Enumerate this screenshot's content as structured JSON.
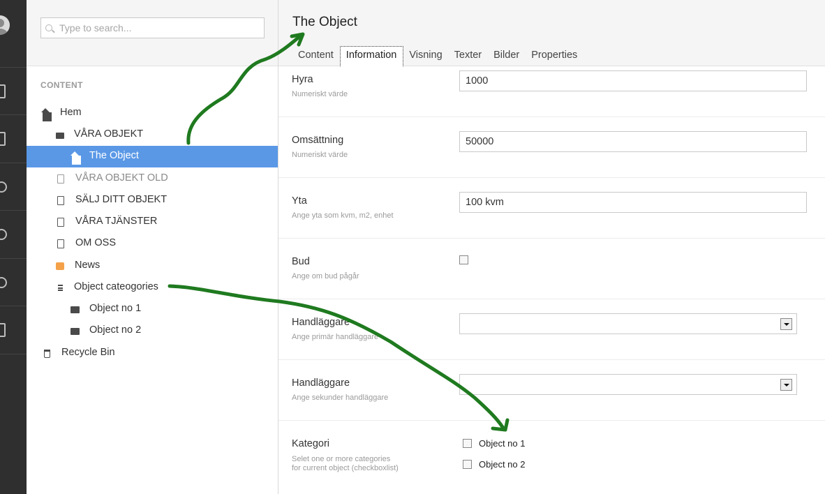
{
  "search": {
    "placeholder": "Type to search..."
  },
  "tree": {
    "heading": "CONTENT",
    "nodes": [
      {
        "label": "Hem",
        "icon": "home-icon"
      },
      {
        "label": "VÅRA OBJEKT",
        "icon": "store-icon"
      },
      {
        "label": "The Object",
        "icon": "home-icon",
        "selected": true
      },
      {
        "label": "VÅRA OBJEKT OLD",
        "icon": "document-icon"
      },
      {
        "label": "SÄLJ DITT OBJEKT",
        "icon": "document-icon"
      },
      {
        "label": "VÅRA TJÄNSTER",
        "icon": "document-icon"
      },
      {
        "label": "OM OSS",
        "icon": "document-icon"
      },
      {
        "label": "News",
        "icon": "box-icon"
      },
      {
        "label": "Object cateogories",
        "icon": "list-icon"
      },
      {
        "label": "Object no 1",
        "icon": "folder-icon"
      },
      {
        "label": "Object no 2",
        "icon": "folder-icon"
      },
      {
        "label": "Recycle Bin",
        "icon": "trash-icon"
      }
    ]
  },
  "editor": {
    "title": "The Object",
    "tabs": [
      "Content",
      "Information",
      "Visning",
      "Texter",
      "Bilder",
      "Properties"
    ],
    "active_tab": "Information",
    "properties": [
      {
        "label": "Hyra",
        "description": "Numeriskt värde",
        "value": "1000"
      },
      {
        "label": "Omsättning",
        "description": "Numeriskt värde",
        "value": "50000"
      },
      {
        "label": "Yta",
        "description": "Ange yta som kvm, m2, enhet",
        "value": "100 kvm"
      },
      {
        "label": "Bud",
        "description": "Ange om bud pågår",
        "checked": false
      },
      {
        "label": "Handläggare",
        "description": "Ange primär handläggare",
        "value": ""
      },
      {
        "label": "Handläggare",
        "description": "Ange sekunder handläggare",
        "value": ""
      },
      {
        "label": "Kategori",
        "description": "Selet one or more categories for current object (checkboxlist)",
        "options": [
          {
            "label": "Object no 1",
            "checked": false
          },
          {
            "label": "Object no 2",
            "checked": false
          }
        ]
      }
    ]
  },
  "annotation": {
    "arrow_color": "#1f7a1f"
  }
}
